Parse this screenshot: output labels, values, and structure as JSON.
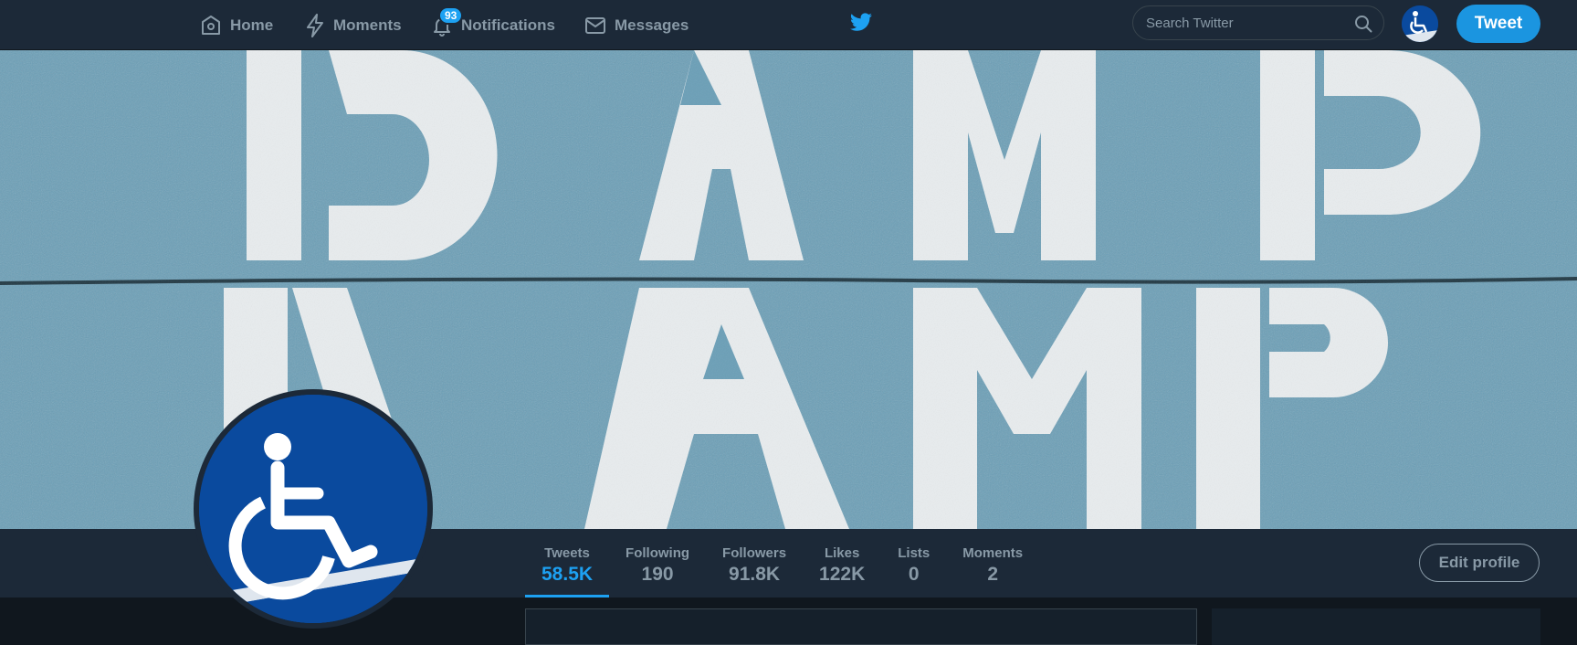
{
  "nav": {
    "home": "Home",
    "moments": "Moments",
    "notifications": "Notifications",
    "notifications_badge": "93",
    "messages": "Messages"
  },
  "search": {
    "placeholder": "Search Twitter"
  },
  "tweet_button": "Tweet",
  "stats": [
    {
      "label": "Tweets",
      "value": "58.5K",
      "active": true
    },
    {
      "label": "Following",
      "value": "190"
    },
    {
      "label": "Followers",
      "value": "91.8K"
    },
    {
      "label": "Likes",
      "value": "122K"
    },
    {
      "label": "Lists",
      "value": "0"
    },
    {
      "label": "Moments",
      "value": "2"
    }
  ],
  "edit_profile": "Edit profile",
  "banner": {
    "text": "RAMP"
  },
  "colors": {
    "accent": "#1da1f2",
    "topbar": "#1c2938",
    "background": "#10171e",
    "avatar_blue": "#0a4a9e"
  },
  "icons": [
    "home-icon",
    "moments-icon",
    "bell-icon",
    "mail-icon",
    "twitter-bird-icon",
    "search-icon",
    "wheelchair-icon"
  ]
}
